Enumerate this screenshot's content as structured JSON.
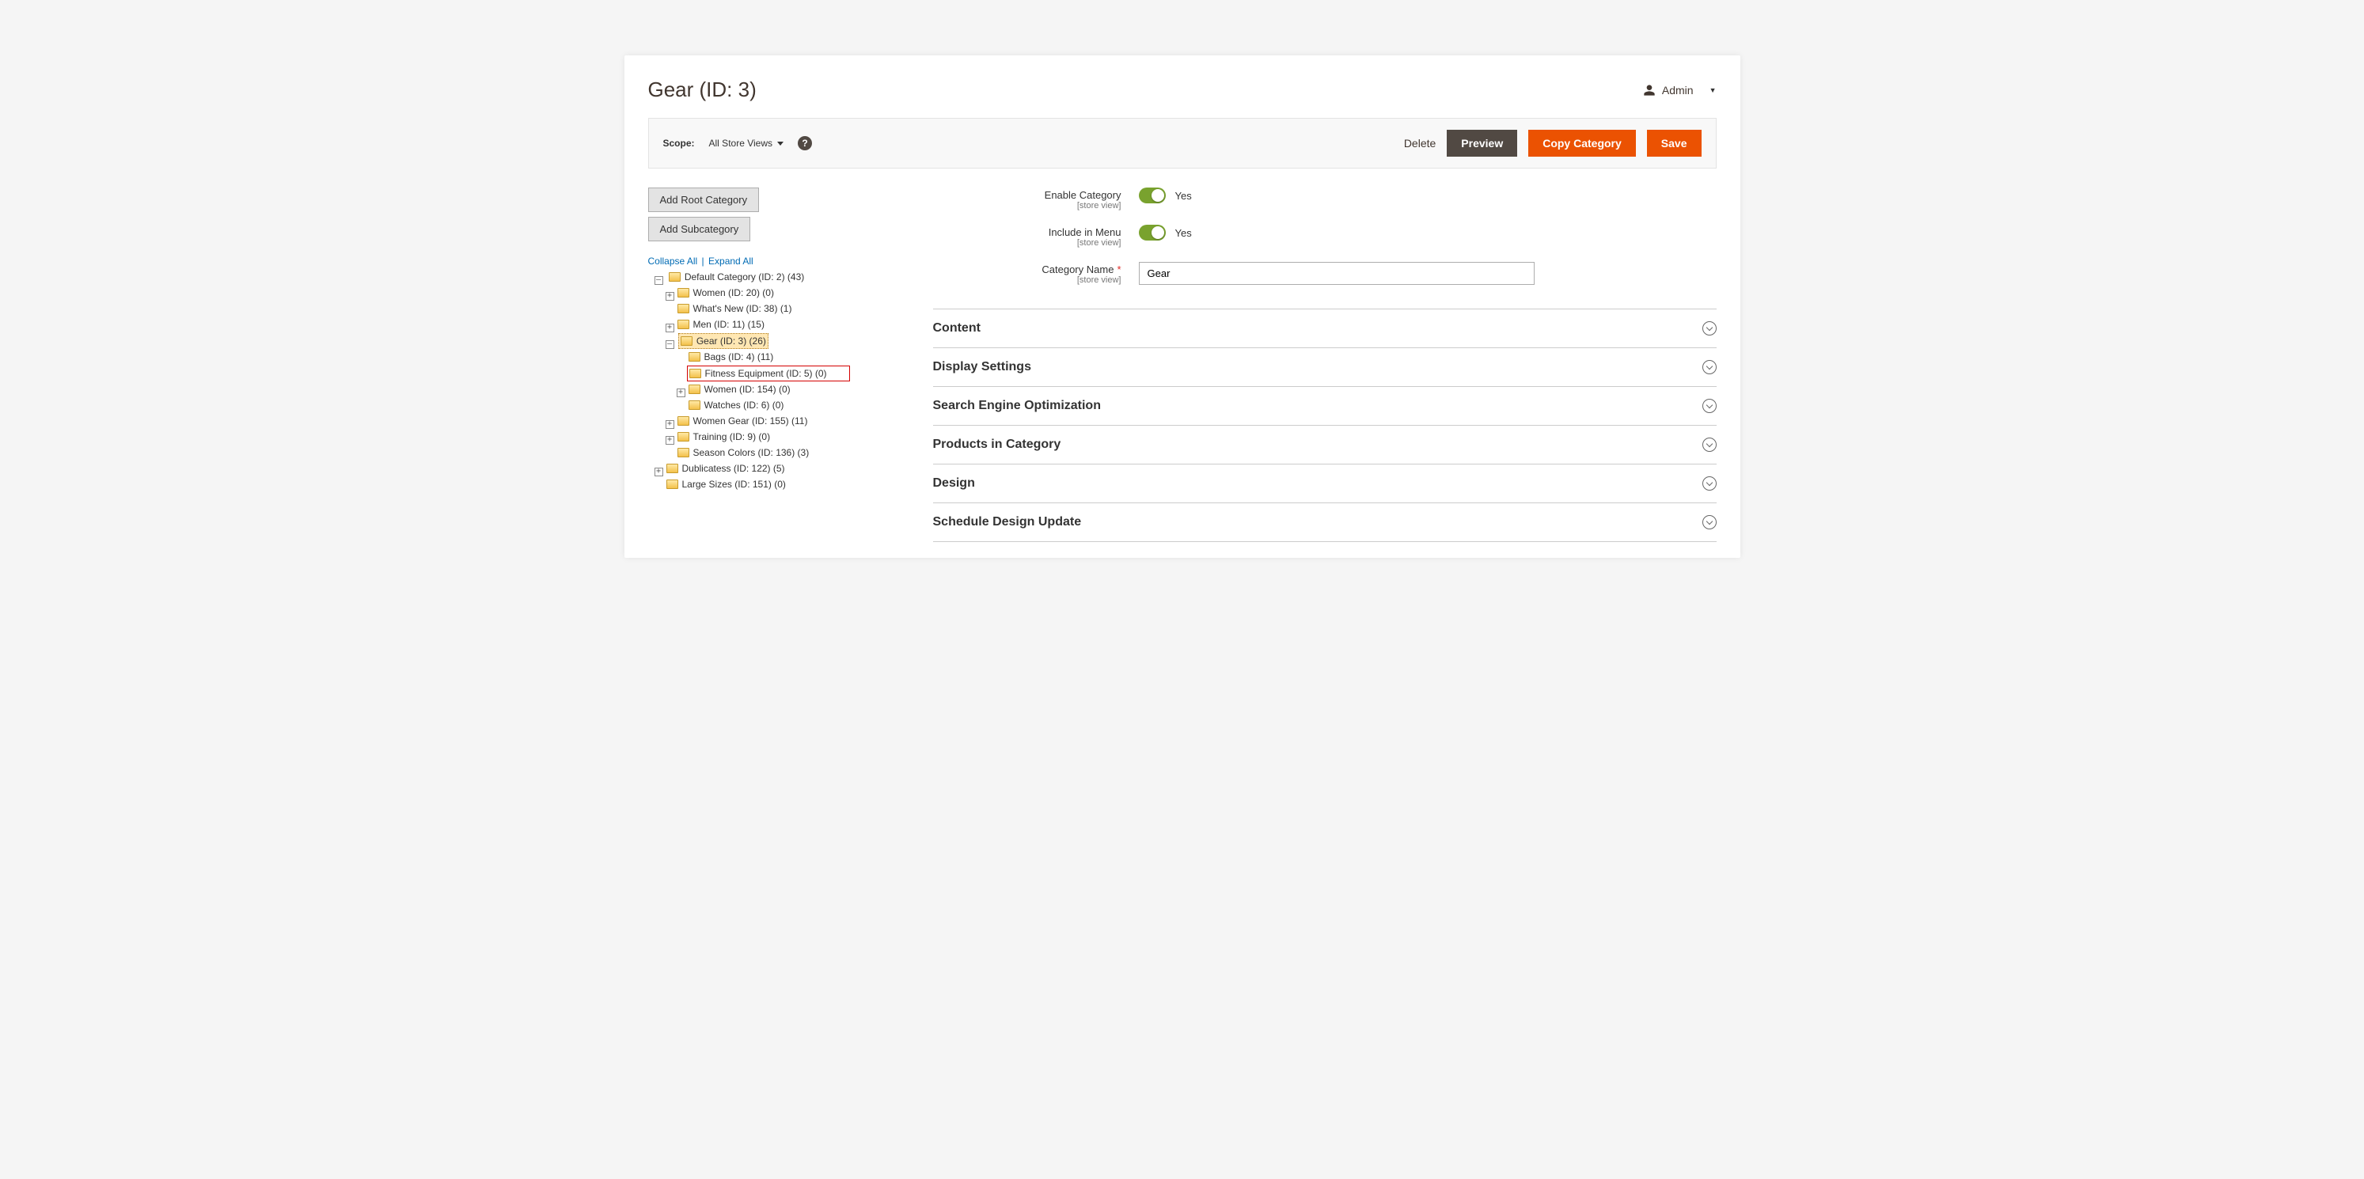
{
  "header": {
    "title": "Gear (ID: 3)",
    "admin_label": "Admin"
  },
  "toolbar": {
    "scope_label": "Scope:",
    "scope_value": "All Store Views",
    "delete": "Delete",
    "preview": "Preview",
    "copy": "Copy Category",
    "save": "Save"
  },
  "sidebar": {
    "add_root": "Add Root Category",
    "add_sub": "Add Subcategory",
    "collapse_all": "Collapse All",
    "expand_all": "Expand All"
  },
  "tree": {
    "n0": "Default Category (ID: 2) (43)",
    "n0_0": "Women (ID: 20) (0)",
    "n0_1": "What's New (ID: 38) (1)",
    "n0_2": "Men (ID: 11) (15)",
    "n0_3": "Gear (ID: 3) (26)",
    "n0_3_0": "Bags (ID: 4) (11)",
    "n0_3_1": "Fitness Equipment (ID: 5) (0)",
    "n0_3_2": "Women (ID: 154) (0)",
    "n0_3_3": "Watches (ID: 6) (0)",
    "n0_4": "Women Gear (ID: 155) (11)",
    "n0_5": "Training (ID: 9) (0)",
    "n0_6": "Season Colors (ID: 136) (3)",
    "n1": "Dublicatess (ID: 122) (5)",
    "n2": "Large Sizes (ID: 151) (0)"
  },
  "form": {
    "enable_label": "Enable Category",
    "enable_note": "[store view]",
    "enable_value": "Yes",
    "include_label": "Include in Menu",
    "include_note": "[store view]",
    "include_value": "Yes",
    "name_label": "Category Name",
    "name_note": "[store view]",
    "name_value": "Gear"
  },
  "fieldsets": {
    "f0": "Content",
    "f1": "Display Settings",
    "f2": "Search Engine Optimization",
    "f3": "Products in Category",
    "f4": "Design",
    "f5": "Schedule Design Update"
  }
}
